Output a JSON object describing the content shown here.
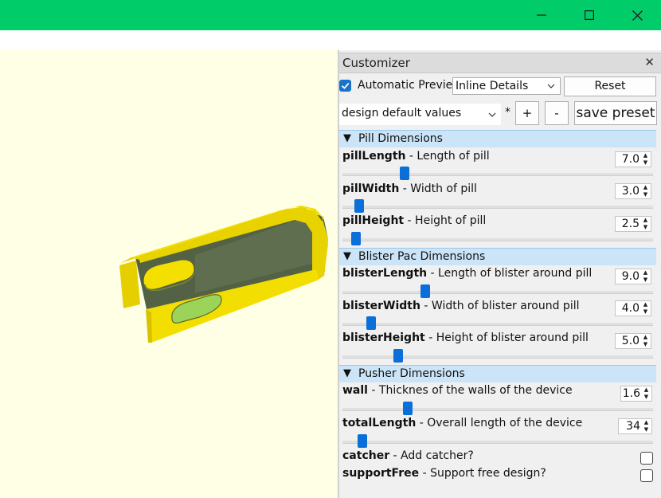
{
  "window": {
    "controls": [
      "minimize-icon",
      "maximize-icon",
      "close-icon"
    ],
    "accent": "#00cc6a"
  },
  "viewport": {
    "background": "#ffffe5",
    "model_colors": [
      "#f2de00",
      "#506040",
      "#9cd45a"
    ]
  },
  "customizer": {
    "title": "Customizer",
    "close_label": "✕",
    "auto_preview": {
      "label": "Automatic Preview",
      "checked": true
    },
    "details_select": {
      "value": "Inline Details"
    },
    "reset_label": "Reset",
    "preset_select": {
      "value": "design default values"
    },
    "preset_modified": "*",
    "add_label": "+",
    "remove_label": "-",
    "save_label": "save preset",
    "groups": [
      {
        "label": "Pill Dimensions",
        "params": [
          {
            "name": "pillLength",
            "desc": " - Length of pill",
            "value": "7.0",
            "slider": 0.19
          },
          {
            "name": "pillWidth",
            "desc": " - Width of pill",
            "value": "3.0",
            "slider": 0.04
          },
          {
            "name": "pillHeight",
            "desc": " - Height of pill",
            "value": "2.5",
            "slider": 0.03
          }
        ]
      },
      {
        "label": "Blister Pac Dimensions",
        "params": [
          {
            "name": "blisterLength",
            "desc": " - Length of blister around pill",
            "value": "9.0",
            "slider": 0.26
          },
          {
            "name": "blisterWidth",
            "desc": " - Width of blister around pill",
            "value": "4.0",
            "slider": 0.08
          },
          {
            "name": "blisterHeight",
            "desc": " - Height of blister around pill",
            "value": "5.0",
            "slider": 0.17
          }
        ]
      },
      {
        "label": "Pusher Dimensions",
        "params": [
          {
            "name": "wall",
            "desc": " - Thicknes of the walls of the device",
            "value": "1.6",
            "slider": 0.2
          },
          {
            "name": "totalLength",
            "desc": " - Overall length of the device",
            "value": "34",
            "slider": 0.05
          }
        ],
        "checks": [
          {
            "name": "catcher",
            "desc": " - Add catcher?",
            "checked": false
          },
          {
            "name": "supportFree",
            "desc": " - Support free design?",
            "checked": false
          }
        ]
      }
    ]
  }
}
